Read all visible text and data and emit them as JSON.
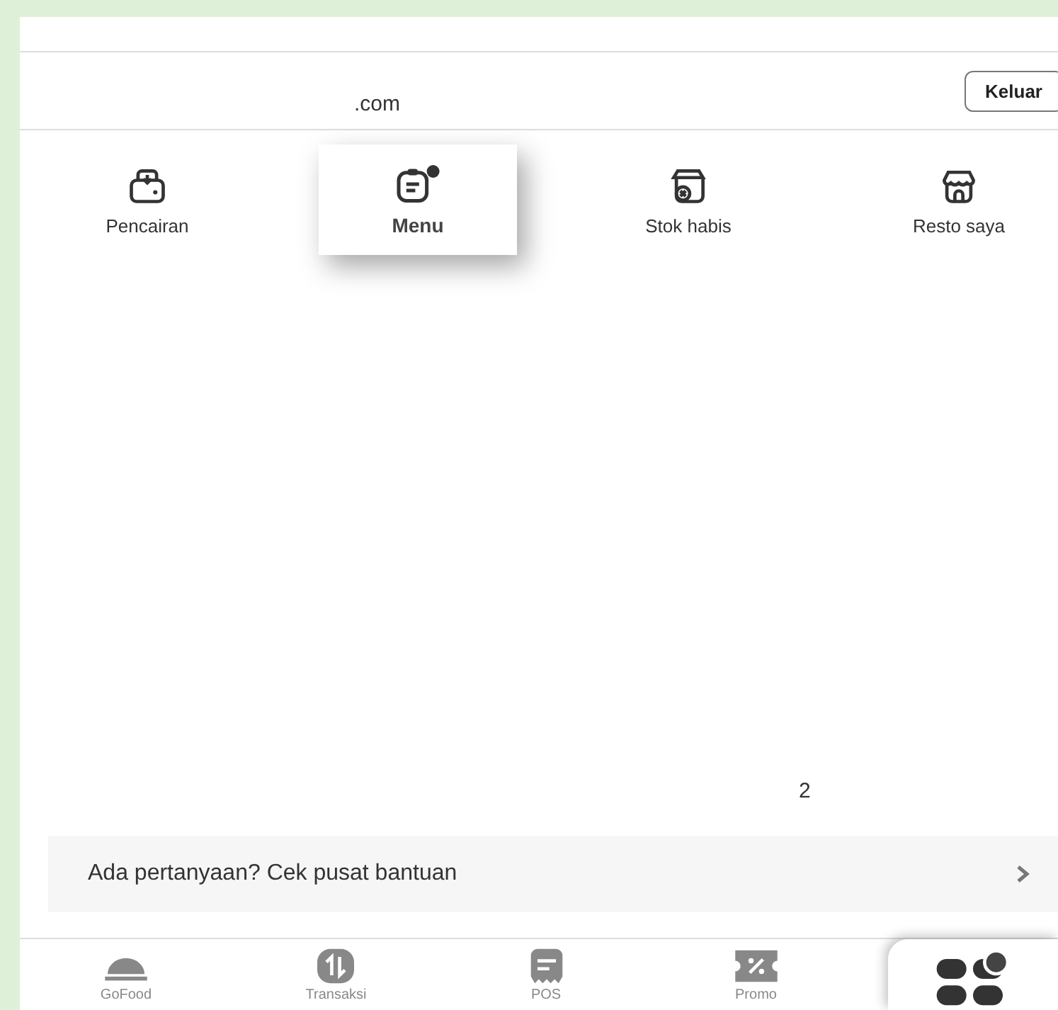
{
  "account": {
    "email": ".com",
    "logout_button": "Keluar"
  },
  "shortcuts": [
    {
      "kind": "wallet",
      "label": "Pencairan",
      "selected": false
    },
    {
      "kind": "menu",
      "label": "Menu",
      "selected": true,
      "badge": true
    },
    {
      "kind": "box",
      "label": "Stok habis",
      "selected": false
    },
    {
      "kind": "store",
      "label": "Resto saya",
      "selected": false
    }
  ],
  "page_number": "2",
  "help_link": "Ada pertanyaan? Cek pusat bantuan",
  "bottom_nav": [
    {
      "kind": "food",
      "label": "GoFood",
      "selected": false
    },
    {
      "kind": "transaction",
      "label": "Transaksi",
      "selected": false
    },
    {
      "kind": "pos",
      "label": "POS",
      "selected": false
    },
    {
      "kind": "promo",
      "label": "Promo",
      "selected": false
    },
    {
      "kind": "more",
      "selected": true,
      "badge": true
    }
  ]
}
